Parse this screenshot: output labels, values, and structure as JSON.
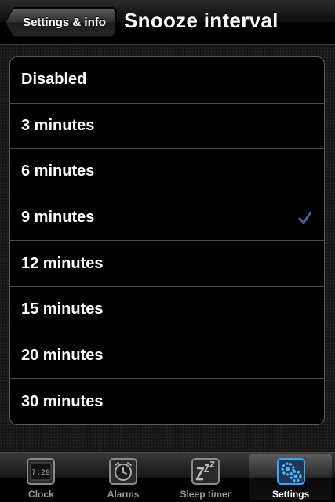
{
  "navbar": {
    "back_label": "Settings & info",
    "title": "Snooze interval"
  },
  "options": [
    {
      "label": "Disabled",
      "selected": false
    },
    {
      "label": "3 minutes",
      "selected": false
    },
    {
      "label": "6 minutes",
      "selected": false
    },
    {
      "label": "9 minutes",
      "selected": true
    },
    {
      "label": "12 minutes",
      "selected": false
    },
    {
      "label": "15 minutes",
      "selected": false
    },
    {
      "label": "20 minutes",
      "selected": false
    },
    {
      "label": "30 minutes",
      "selected": false
    }
  ],
  "tabbar": {
    "tabs": [
      {
        "label": "Clock",
        "icon": "clock-icon",
        "clock_text": "7:29",
        "active": false
      },
      {
        "label": "Alarms",
        "icon": "alarm-icon",
        "active": false
      },
      {
        "label": "Sleep timer",
        "icon": "sleep-timer-icon",
        "active": false
      },
      {
        "label": "Settings",
        "icon": "settings-gear-icon",
        "active": true
      }
    ]
  },
  "colors": {
    "checkmark": "#4a5f9a",
    "settings_icon_accent": "#3aa6ff"
  }
}
